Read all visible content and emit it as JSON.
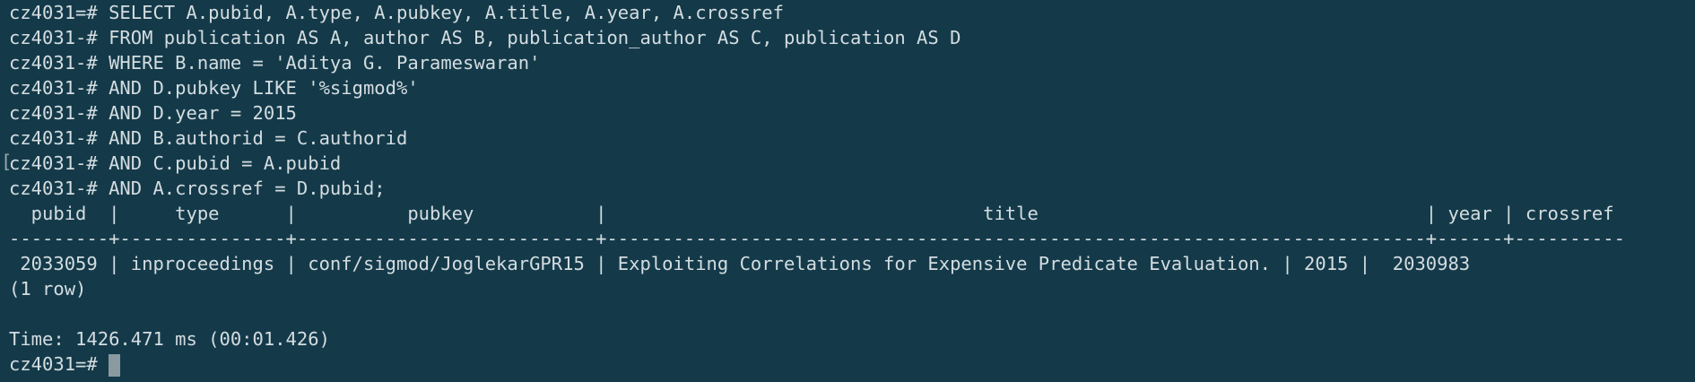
{
  "terminal": {
    "mark": "[",
    "lines": [
      "cz4031=# SELECT A.pubid, A.type, A.pubkey, A.title, A.year, A.crossref",
      "cz4031-# FROM publication AS A, author AS B, publication_author AS C, publication AS D",
      "cz4031-# WHERE B.name = 'Aditya G. Parameswaran'",
      "cz4031-# AND D.pubkey LIKE '%sigmod%'",
      "cz4031-# AND D.year = 2015",
      "cz4031-# AND B.authorid = C.authorid",
      "cz4031-# AND C.pubid = A.pubid",
      "cz4031-# AND A.crossref = D.pubid;",
      "  pubid  |     type      |          pubkey           |                                  title                                   | year | crossref",
      "---------+---------------+---------------------------+--------------------------------------------------------------------------+------+----------",
      " 2033059 | inproceedings | conf/sigmod/JoglekarGPR15 | Exploiting Correlations for Expensive Predicate Evaluation. | 2015 |  2030983",
      "(1 row)",
      "",
      "Time: 1426.471 ms (00:01.426)"
    ],
    "prompt": "cz4031=# "
  }
}
